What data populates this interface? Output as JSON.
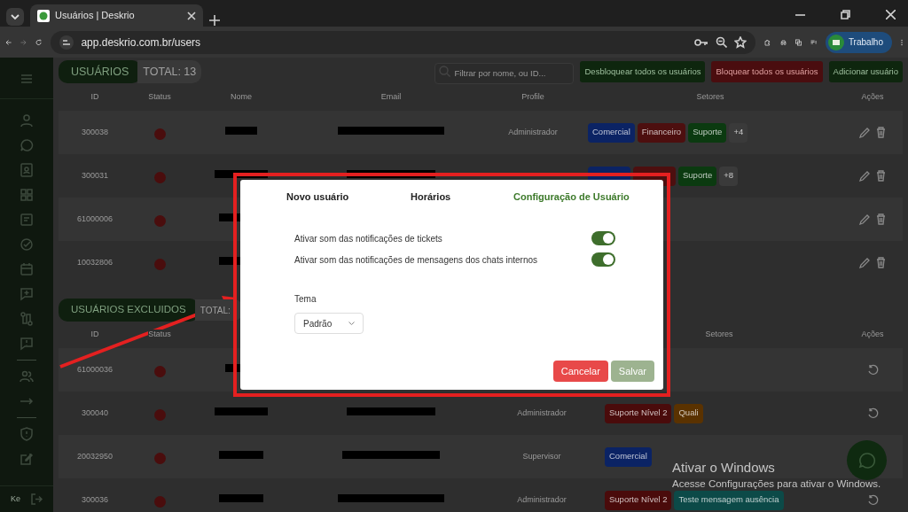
{
  "browser": {
    "tab_title": "Usuários | Deskrio",
    "address": "app.deskrio.com.br/users",
    "profile": "Trabalho"
  },
  "sidebar": {
    "user_initials": "Ke"
  },
  "users": {
    "title": "USUÁRIOS",
    "total": "TOTAL: 13",
    "search_placeholder": "Filtrar por nome, ou ID...",
    "buttons": [
      {
        "label": "Desbloquear todos os usuários",
        "kind": "unblock"
      },
      {
        "label": "Bloquear todos os usuários",
        "kind": "block"
      },
      {
        "label": "Adicionar usuário",
        "kind": "add"
      }
    ],
    "columns": [
      "ID",
      "Status",
      "Nome",
      "Email",
      "Profile",
      "Setores",
      "Ações"
    ],
    "rows": [
      {
        "id": "300038",
        "online": false,
        "profile": "Administrador",
        "tags": [
          {
            "label": "Comercial",
            "color": "#0b2364"
          },
          {
            "label": "Financeiro",
            "color": "#4d0f0f"
          },
          {
            "label": "Suporte",
            "color": "#0b3a10"
          },
          {
            "label": "+4",
            "color": "#3a3a3a"
          }
        ]
      },
      {
        "id": "300031",
        "online": false,
        "tags": [
          {
            "color": "#0b2364"
          },
          {
            "color": "#4d0f0f"
          },
          {
            "label": "Suporte",
            "color": "#0b3a10"
          },
          {
            "label": "+8",
            "color": "#3a3a3a"
          }
        ]
      },
      {
        "id": "61000006",
        "online": false,
        "tags": []
      },
      {
        "id": "10032806",
        "online": false,
        "tags": []
      }
    ]
  },
  "excluded": {
    "title": "USUÁRIOS EXCLUIDOS",
    "total": "TOTAL:",
    "columns": [
      "ID",
      "Status",
      "Setores",
      "Ações"
    ],
    "rows": [
      {
        "id": "61000036",
        "online": false,
        "tags": []
      },
      {
        "id": "300040",
        "online": false,
        "profile": "Administrador",
        "tags": [
          {
            "label": "Suporte Nível 2",
            "color": "#4a0b0b"
          },
          {
            "label": "Quali",
            "color": "#5a3200"
          }
        ]
      },
      {
        "id": "20032950",
        "online": false,
        "profile": "Supervisor",
        "tags": [
          {
            "label": "Comercial",
            "color": "#0b2364"
          }
        ]
      },
      {
        "id": "300036",
        "online": false,
        "profile": "Administrador",
        "tags": [
          {
            "label": "Suporte Nível 2",
            "color": "#4a0b0b"
          },
          {
            "label": "Teste mensagem ausência",
            "color": "#0c4a48"
          }
        ]
      }
    ]
  },
  "modal": {
    "tabs": [
      {
        "label": "Novo usuário",
        "selected": false
      },
      {
        "label": "Horários",
        "selected": false
      },
      {
        "label": "Configuração de Usuário",
        "selected": true
      }
    ],
    "settings": [
      {
        "label": "Ativar som das notificações de tickets",
        "on": true
      },
      {
        "label": "Ativar som das notificações de mensagens dos chats internos",
        "on": true
      }
    ],
    "theme_label": "Tema",
    "theme_value": "Padrão",
    "buttons": [
      {
        "label": "Cancelar",
        "kind": "cancel"
      },
      {
        "label": "Salvar",
        "kind": "save"
      }
    ]
  },
  "windows_activation": {
    "title": "Ativar o Windows",
    "message": "Acesse Configurações para ativar o Windows."
  }
}
